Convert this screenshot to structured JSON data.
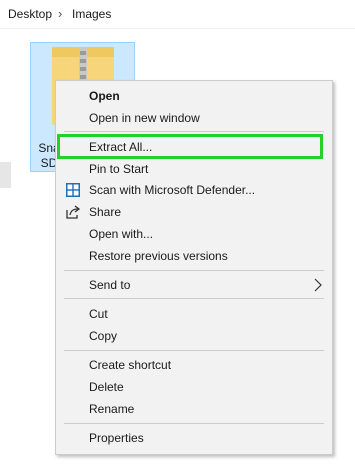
{
  "breadcrumb": {
    "items": [
      "Desktop",
      "Images"
    ],
    "separator": "›"
  },
  "file": {
    "label_line1": "Sna",
    "label_line2": "SD",
    "icon": "zip-folder-icon",
    "selected_bg": "#cce8ff"
  },
  "context_menu": {
    "highlight_color": "#22d12c",
    "items": {
      "open": "Open",
      "open_new_window": "Open in new window",
      "extract_all": "Extract All...",
      "pin_to_start": "Pin to Start",
      "scan_defender": "Scan with Microsoft Defender...",
      "share": "Share",
      "open_with": "Open with...",
      "restore_versions": "Restore previous versions",
      "send_to": "Send to",
      "cut": "Cut",
      "copy": "Copy",
      "create_shortcut": "Create shortcut",
      "delete": "Delete",
      "rename": "Rename",
      "properties": "Properties"
    },
    "icons": {
      "scan_defender": "defender-shield-icon",
      "share": "share-icon",
      "send_to": "chevron-right-icon"
    }
  }
}
